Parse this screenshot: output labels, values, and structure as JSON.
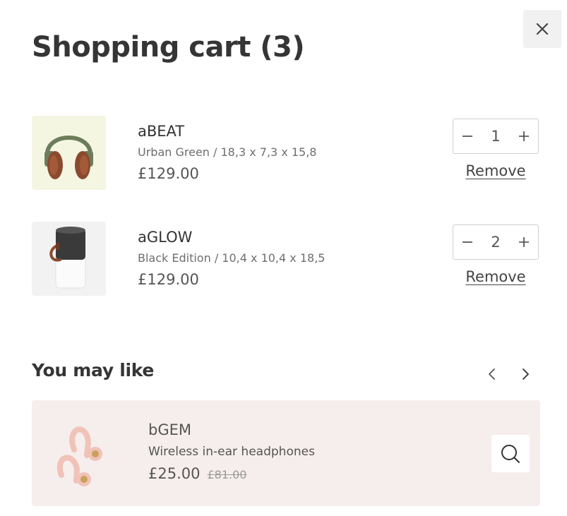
{
  "cart": {
    "title": "Shopping cart (3)",
    "items": [
      {
        "name": "aBEAT",
        "variant": "Urban Green / 18,3 x 7,3 x 15,8",
        "price": "£129.00",
        "quantity": "1",
        "remove_label": "Remove",
        "thumb_bg": "#f4f6e2"
      },
      {
        "name": "aGLOW",
        "variant": "Black Edition / 10,4 x 10,4 x 18,5",
        "price": "£129.00",
        "quantity": "2",
        "remove_label": "Remove",
        "thumb_bg": "#f2f2f2"
      }
    ]
  },
  "recommendations": {
    "title": "You may like",
    "items": [
      {
        "name": "bGEM",
        "description": "Wireless in-ear headphones",
        "price": "£25.00",
        "old_price": "£81.00"
      }
    ]
  },
  "icons": {
    "close": "close-icon",
    "minus": "minus-icon",
    "plus": "plus-icon",
    "prev": "chevron-left-icon",
    "next": "chevron-right-icon",
    "search": "search-icon"
  },
  "colors": {
    "card_background": "#f5eeec",
    "close_background": "#f1f1f1"
  }
}
